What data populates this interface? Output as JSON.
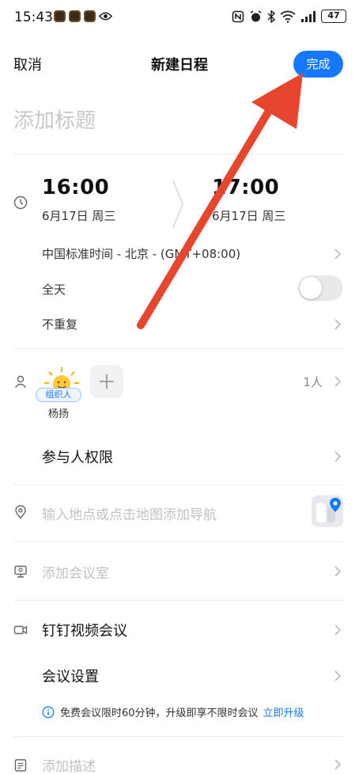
{
  "status_bar": {
    "time": "15:43",
    "battery": "47"
  },
  "header": {
    "cancel": "取消",
    "title": "新建日程",
    "done": "完成"
  },
  "title_field": {
    "placeholder": "添加标题"
  },
  "time_block": {
    "start_time": "16:00",
    "start_date": "6月17日 周三",
    "end_time": "17:00",
    "end_date": "6月17日 周三",
    "timezone": "中国标准时间 - 北京 - (GMT+08:00)",
    "all_day": "全天",
    "all_day_on": false,
    "repeat": "不重复"
  },
  "participants": {
    "organizer_badge": "组织人",
    "organizer_name": "杨扬",
    "count": "1人",
    "permissions": "参与人权限"
  },
  "location": {
    "placeholder": "输入地点或点击地图添加导航"
  },
  "meeting_room": {
    "label": "添加会议室"
  },
  "video": {
    "label": "钉钉视频会议",
    "settings": "会议设置",
    "notice": "免费会议限时60分钟，升级即享不限时会议",
    "upgrade": "立即升级"
  },
  "description": {
    "label": "添加描述"
  },
  "colors": {
    "accent": "#1677ff",
    "annotation_arrow": "#e8452f"
  }
}
